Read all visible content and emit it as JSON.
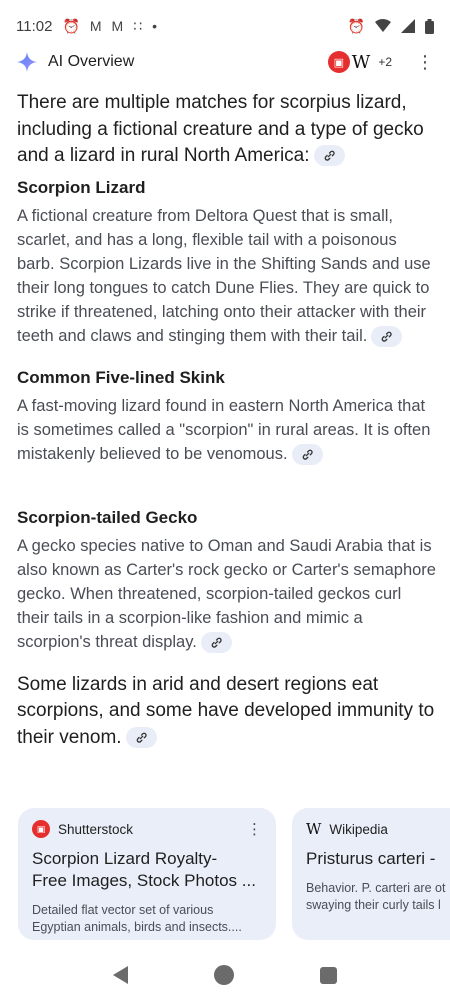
{
  "status_bar": {
    "time": "11:02",
    "left_icons": [
      "alarm-icon",
      "gmail-icon",
      "gmail-icon",
      "grid-icon",
      "dot-icon"
    ],
    "right_icons": [
      "alarm-icon",
      "wifi-icon",
      "signal-icon",
      "battery-icon"
    ]
  },
  "header": {
    "title": "AI Overview",
    "sources_more": "+2",
    "source_icons": [
      "shutterstock-icon",
      "wikipedia-icon"
    ]
  },
  "overview": {
    "intro": "There are multiple matches for scorpius lizard, including a fictional creature and a type of gecko and a lizard in rural North America:",
    "sections": [
      {
        "heading": "Scorpion Lizard",
        "body": "A fictional creature from Deltora Quest that is small, scarlet, and has a long, flexible tail with a poisonous barb. Scorpion Lizards live in the Shifting Sands and use their long tongues to catch Dune Flies. They are quick to strike if threatened, latching onto their attacker with their teeth and claws and stinging them with their tail."
      },
      {
        "heading": "Common Five-lined Skink",
        "body": "A fast-moving lizard found in eastern North America that is sometimes called a \"scorpion\" in rural areas. It is often mistakenly believed to be venomous."
      },
      {
        "heading": "Scorpion-tailed Gecko",
        "body": "A gecko species native to Oman and Saudi Arabia that is also known as Carter's rock gecko or Carter's semaphore gecko. When threatened, scorpion-tailed geckos curl their tails in a scorpion-like fashion and mimic a scorpion's threat display."
      }
    ],
    "closing": "Some lizards in arid and desert regions eat scorpions, and some have developed immunity to their venom."
  },
  "source_cards": [
    {
      "source": "Shutterstock",
      "title": "Scorpion Lizard Royalty-Free Images, Stock Photos ...",
      "title_line1": "Scorpion Lizard Royalty-",
      "title_line2": "Free Images, Stock Photos ...",
      "desc_line1": "Detailed flat vector set of various",
      "desc_line2": "Egyptian animals, birds and insects...."
    },
    {
      "source": "Wikipedia",
      "title": "Pristurus carteri -",
      "desc_line1": "Behavior. P. carteri are ot",
      "desc_line2": "swaying their curly tails l"
    }
  ],
  "colors": {
    "accent_chip": "#e8edf7",
    "card_bg": "#e9eef8",
    "shutterstock_red": "#e62e2e"
  }
}
